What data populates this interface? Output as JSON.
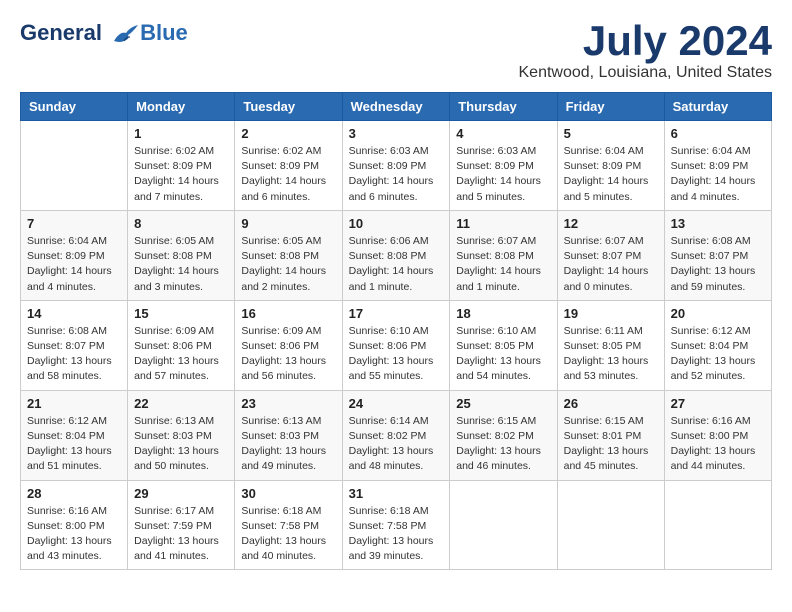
{
  "logo": {
    "line1": "General",
    "line2": "Blue"
  },
  "title": "July 2024",
  "location": "Kentwood, Louisiana, United States",
  "days_of_week": [
    "Sunday",
    "Monday",
    "Tuesday",
    "Wednesday",
    "Thursday",
    "Friday",
    "Saturday"
  ],
  "weeks": [
    [
      {
        "day": "",
        "info": ""
      },
      {
        "day": "1",
        "info": "Sunrise: 6:02 AM\nSunset: 8:09 PM\nDaylight: 14 hours\nand 7 minutes."
      },
      {
        "day": "2",
        "info": "Sunrise: 6:02 AM\nSunset: 8:09 PM\nDaylight: 14 hours\nand 6 minutes."
      },
      {
        "day": "3",
        "info": "Sunrise: 6:03 AM\nSunset: 8:09 PM\nDaylight: 14 hours\nand 6 minutes."
      },
      {
        "day": "4",
        "info": "Sunrise: 6:03 AM\nSunset: 8:09 PM\nDaylight: 14 hours\nand 5 minutes."
      },
      {
        "day": "5",
        "info": "Sunrise: 6:04 AM\nSunset: 8:09 PM\nDaylight: 14 hours\nand 5 minutes."
      },
      {
        "day": "6",
        "info": "Sunrise: 6:04 AM\nSunset: 8:09 PM\nDaylight: 14 hours\nand 4 minutes."
      }
    ],
    [
      {
        "day": "7",
        "info": "Sunrise: 6:04 AM\nSunset: 8:09 PM\nDaylight: 14 hours\nand 4 minutes."
      },
      {
        "day": "8",
        "info": "Sunrise: 6:05 AM\nSunset: 8:08 PM\nDaylight: 14 hours\nand 3 minutes."
      },
      {
        "day": "9",
        "info": "Sunrise: 6:05 AM\nSunset: 8:08 PM\nDaylight: 14 hours\nand 2 minutes."
      },
      {
        "day": "10",
        "info": "Sunrise: 6:06 AM\nSunset: 8:08 PM\nDaylight: 14 hours\nand 1 minute."
      },
      {
        "day": "11",
        "info": "Sunrise: 6:07 AM\nSunset: 8:08 PM\nDaylight: 14 hours\nand 1 minute."
      },
      {
        "day": "12",
        "info": "Sunrise: 6:07 AM\nSunset: 8:07 PM\nDaylight: 14 hours\nand 0 minutes."
      },
      {
        "day": "13",
        "info": "Sunrise: 6:08 AM\nSunset: 8:07 PM\nDaylight: 13 hours\nand 59 minutes."
      }
    ],
    [
      {
        "day": "14",
        "info": "Sunrise: 6:08 AM\nSunset: 8:07 PM\nDaylight: 13 hours\nand 58 minutes."
      },
      {
        "day": "15",
        "info": "Sunrise: 6:09 AM\nSunset: 8:06 PM\nDaylight: 13 hours\nand 57 minutes."
      },
      {
        "day": "16",
        "info": "Sunrise: 6:09 AM\nSunset: 8:06 PM\nDaylight: 13 hours\nand 56 minutes."
      },
      {
        "day": "17",
        "info": "Sunrise: 6:10 AM\nSunset: 8:06 PM\nDaylight: 13 hours\nand 55 minutes."
      },
      {
        "day": "18",
        "info": "Sunrise: 6:10 AM\nSunset: 8:05 PM\nDaylight: 13 hours\nand 54 minutes."
      },
      {
        "day": "19",
        "info": "Sunrise: 6:11 AM\nSunset: 8:05 PM\nDaylight: 13 hours\nand 53 minutes."
      },
      {
        "day": "20",
        "info": "Sunrise: 6:12 AM\nSunset: 8:04 PM\nDaylight: 13 hours\nand 52 minutes."
      }
    ],
    [
      {
        "day": "21",
        "info": "Sunrise: 6:12 AM\nSunset: 8:04 PM\nDaylight: 13 hours\nand 51 minutes."
      },
      {
        "day": "22",
        "info": "Sunrise: 6:13 AM\nSunset: 8:03 PM\nDaylight: 13 hours\nand 50 minutes."
      },
      {
        "day": "23",
        "info": "Sunrise: 6:13 AM\nSunset: 8:03 PM\nDaylight: 13 hours\nand 49 minutes."
      },
      {
        "day": "24",
        "info": "Sunrise: 6:14 AM\nSunset: 8:02 PM\nDaylight: 13 hours\nand 48 minutes."
      },
      {
        "day": "25",
        "info": "Sunrise: 6:15 AM\nSunset: 8:02 PM\nDaylight: 13 hours\nand 46 minutes."
      },
      {
        "day": "26",
        "info": "Sunrise: 6:15 AM\nSunset: 8:01 PM\nDaylight: 13 hours\nand 45 minutes."
      },
      {
        "day": "27",
        "info": "Sunrise: 6:16 AM\nSunset: 8:00 PM\nDaylight: 13 hours\nand 44 minutes."
      }
    ],
    [
      {
        "day": "28",
        "info": "Sunrise: 6:16 AM\nSunset: 8:00 PM\nDaylight: 13 hours\nand 43 minutes."
      },
      {
        "day": "29",
        "info": "Sunrise: 6:17 AM\nSunset: 7:59 PM\nDaylight: 13 hours\nand 41 minutes."
      },
      {
        "day": "30",
        "info": "Sunrise: 6:18 AM\nSunset: 7:58 PM\nDaylight: 13 hours\nand 40 minutes."
      },
      {
        "day": "31",
        "info": "Sunrise: 6:18 AM\nSunset: 7:58 PM\nDaylight: 13 hours\nand 39 minutes."
      },
      {
        "day": "",
        "info": ""
      },
      {
        "day": "",
        "info": ""
      },
      {
        "day": "",
        "info": ""
      }
    ]
  ]
}
